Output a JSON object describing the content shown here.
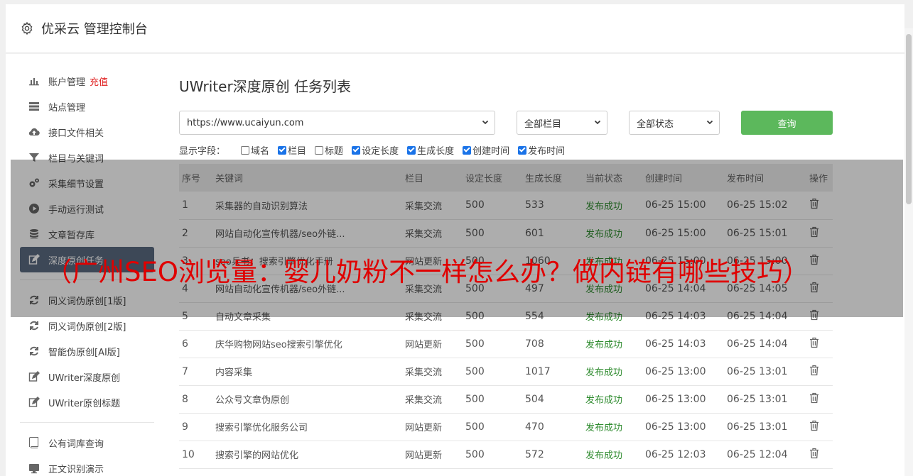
{
  "header": {
    "title": "优采云 管理控制台"
  },
  "sidebar": {
    "items": [
      {
        "label": "账户管理",
        "badge": "充值",
        "icon": "bar-chart-icon"
      },
      {
        "label": "站点管理",
        "icon": "server-icon"
      },
      {
        "label": "接口文件相关",
        "icon": "cloud-upload-icon"
      },
      {
        "label": "栏目与关键词",
        "icon": "filter-icon"
      },
      {
        "label": "采集细节设置",
        "icon": "gears-icon"
      },
      {
        "label": "手动运行测试",
        "icon": "play-icon"
      },
      {
        "label": "文章暂存库",
        "icon": "database-icon"
      },
      {
        "label": "深度原创任务",
        "icon": "edit-icon"
      },
      {
        "label": "同义词伪原创[1版]",
        "icon": "refresh-icon"
      },
      {
        "label": "同义词伪原创[2版]",
        "icon": "refresh-icon"
      },
      {
        "label": "智能伪原创[AI版]",
        "icon": "refresh-icon"
      },
      {
        "label": "UWriter深度原创",
        "icon": "edit-icon"
      },
      {
        "label": "UWriter原创标题",
        "icon": "edit-icon"
      },
      {
        "label": "公有词库查询",
        "icon": "book-icon"
      },
      {
        "label": "正文识别演示",
        "icon": "monitor-icon"
      }
    ]
  },
  "main": {
    "title": "UWriter深度原创 任务列表",
    "site_select": "https://www.ucaiyun.com",
    "column_select": "全部栏目",
    "status_select": "全部状态",
    "query_label": "查询",
    "fields_label": "显示字段：",
    "fields": [
      {
        "label": "域名",
        "checked": false
      },
      {
        "label": "栏目",
        "checked": true
      },
      {
        "label": "标题",
        "checked": false
      },
      {
        "label": "设定长度",
        "checked": true
      },
      {
        "label": "生成长度",
        "checked": true
      },
      {
        "label": "创建时间",
        "checked": true
      },
      {
        "label": "发布时间",
        "checked": true
      }
    ],
    "table": {
      "headers": [
        "序号",
        "关键词",
        "栏目",
        "设定长度",
        "生成长度",
        "当前状态",
        "创建时间",
        "发布时间",
        "操作"
      ],
      "rows": [
        [
          "1",
          "采集器的自动识别算法",
          "采集交流",
          "500",
          "533",
          "发布成功",
          "06-25 15:00",
          "06-25 15:02"
        ],
        [
          "2",
          "网站自动化宣传机器/seo外链...",
          "采集交流",
          "500",
          "601",
          "发布成功",
          "06-25 15:00",
          "06-25 15:01"
        ],
        [
          "3",
          "seo兵书：搜索引擎优化手册",
          "网站更新",
          "500",
          "1060",
          "发布成功",
          "06-25 15:00",
          "06-25 15:00"
        ],
        [
          "4",
          "网站自动化宣传机器/seo外链...",
          "采集交流",
          "500",
          "497",
          "发布成功",
          "06-25 14:04",
          "06-25 14:05"
        ],
        [
          "5",
          "自动文章采集",
          "采集交流",
          "500",
          "554",
          "发布成功",
          "06-25 14:03",
          "06-25 14:04"
        ],
        [
          "6",
          "庆华购物网站seo搜索引擎优化",
          "网站更新",
          "500",
          "708",
          "发布成功",
          "06-25 14:03",
          "06-25 14:04"
        ],
        [
          "7",
          "内容采集",
          "采集交流",
          "500",
          "1017",
          "发布成功",
          "06-25 13:00",
          "06-25 13:01"
        ],
        [
          "8",
          "公众号文章伪原创",
          "采集交流",
          "500",
          "504",
          "发布成功",
          "06-25 13:00",
          "06-25 13:01"
        ],
        [
          "9",
          "搜索引擎优化服务公司",
          "网站更新",
          "500",
          "470",
          "发布成功",
          "06-25 13:00",
          "06-25 13:01"
        ],
        [
          "10",
          "搜索引擎的网站优化",
          "网站更新",
          "500",
          "572",
          "发布成功",
          "06-25 12:03",
          "06-25 12:04"
        ]
      ]
    }
  },
  "overlay": {
    "text": "（广州SEO浏览量：婴儿奶粉不一样怎么办？做内链有哪些技巧）"
  },
  "colors": {
    "accent_green": "#5cb85c",
    "active_sidebar": "#5b6b80",
    "badge_red": "#e02020",
    "success": "#2e8b2e"
  }
}
